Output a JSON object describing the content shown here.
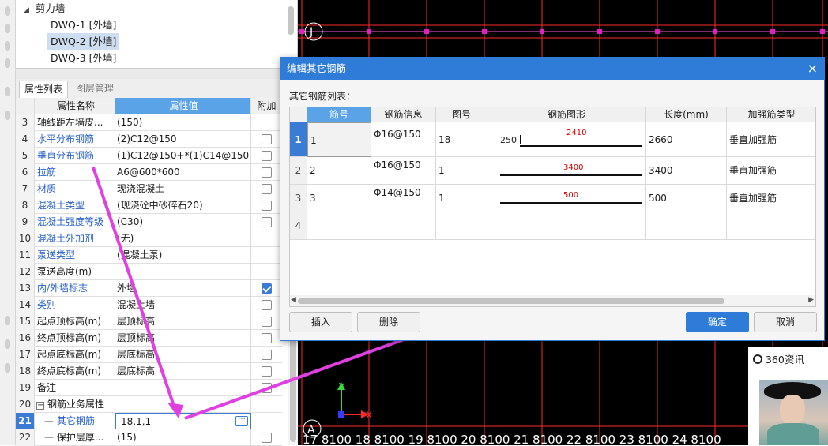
{
  "tree": {
    "root_label": "剪力墙",
    "items": [
      {
        "label": "DWQ-1 [外墙]"
      },
      {
        "label": "DWQ-2 [外墙]",
        "selected": true
      },
      {
        "label": "DWQ-3 [外墙]"
      }
    ]
  },
  "tabs": [
    {
      "label": "属性列表",
      "active": true
    },
    {
      "label": "图层管理",
      "active": false
    }
  ],
  "prop_grid": {
    "headers": {
      "name": "属性名称",
      "value": "属性值",
      "add": "附加"
    },
    "rows": [
      {
        "num": "3",
        "name": "轴线距左墙皮...",
        "value": "(150)",
        "check": false,
        "blue": false
      },
      {
        "num": "4",
        "name": "水平分布钢筋",
        "value": "(2)C12@150",
        "check": true,
        "blue": true
      },
      {
        "num": "5",
        "name": "垂直分布钢筋",
        "value": "(1)C12@150+*(1)C14@150",
        "check": true,
        "blue": true
      },
      {
        "num": "6",
        "name": "拉筋",
        "value": "A6@600*600",
        "check": true,
        "blue": true
      },
      {
        "num": "7",
        "name": "材质",
        "value": "现浇混凝土",
        "check": true,
        "blue": true
      },
      {
        "num": "8",
        "name": "混凝土类型",
        "value": "(现浇砼中砂碎石20)",
        "check": true,
        "blue": true
      },
      {
        "num": "9",
        "name": "混凝土强度等级",
        "value": "(C30)",
        "check": true,
        "blue": true
      },
      {
        "num": "10",
        "name": "混凝土外加剂",
        "value": "(无)",
        "check": null,
        "blue": true
      },
      {
        "num": "11",
        "name": "泵送类型",
        "value": "(混凝土泵)",
        "check": null,
        "blue": true
      },
      {
        "num": "12",
        "name": "泵送高度(m)",
        "value": "",
        "check": null,
        "blue": false
      },
      {
        "num": "13",
        "name": "内/外墙标志",
        "value": "外墙",
        "check": "on",
        "blue": true
      },
      {
        "num": "14",
        "name": "类别",
        "value": "混凝土墙",
        "check": true,
        "blue": true
      },
      {
        "num": "15",
        "name": "起点顶标高(m)",
        "value": "层顶标高",
        "check": true,
        "blue": false
      },
      {
        "num": "16",
        "name": "终点顶标高(m)",
        "value": "层顶标高",
        "check": true,
        "blue": false
      },
      {
        "num": "17",
        "name": "起点底标高(m)",
        "value": "层底标高",
        "check": true,
        "blue": false
      },
      {
        "num": "18",
        "name": "终点底标高(m)",
        "value": "层底标高",
        "check": true,
        "blue": false
      },
      {
        "num": "19",
        "name": "备注",
        "value": "",
        "check": true,
        "blue": false
      },
      {
        "num": "20",
        "name": "钢筋业务属性",
        "value": "",
        "check": null,
        "blue": false,
        "group": true
      },
      {
        "num": "21",
        "name": "其它钢筋",
        "value": "18,1,1",
        "check": null,
        "blue": true,
        "selected": true
      },
      {
        "num": "22",
        "name": "保护层厚...",
        "value": "(15)",
        "check": true,
        "blue": false
      }
    ]
  },
  "cad": {
    "axis_labels": {
      "top": "J",
      "bottom": "A",
      "x": "X",
      "y": "Y"
    },
    "dimension_text": "17 8100 18 8100 19 8100 20 8100 21 8100 22 8100 23 8100 24 8100"
  },
  "dialog": {
    "title": "编辑其它钢筋",
    "close_glyph": "×",
    "list_label": "其它钢筋列表：",
    "columns": [
      "筋号",
      "钢筋信息",
      "图号",
      "钢筋图形",
      "长度(mm)",
      "加强筋类型"
    ],
    "rows": [
      {
        "num": "1",
        "bar_no": "1",
        "info": "Φ16@150",
        "fig": "18",
        "shape_left": "250",
        "shape_main": "2410",
        "length": "2660",
        "type": "垂直加强筋"
      },
      {
        "num": "2",
        "bar_no": "2",
        "info": "Φ16@150",
        "fig": "1",
        "shape_left": "",
        "shape_main": "3400",
        "length": "3400",
        "type": "垂直加强筋"
      },
      {
        "num": "3",
        "bar_no": "3",
        "info": "Φ14@150",
        "fig": "1",
        "shape_left": "",
        "shape_main": "500",
        "length": "500",
        "type": "垂直加强筋"
      },
      {
        "num": "4",
        "bar_no": "",
        "info": "",
        "fig": "",
        "shape_left": "",
        "shape_main": "",
        "length": "",
        "type": ""
      }
    ],
    "buttons": {
      "insert": "插入",
      "delete": "删除",
      "ok": "确定",
      "cancel": "取消"
    }
  },
  "news": {
    "title": "360资讯"
  },
  "colors": {
    "accent": "#2f7bd8",
    "grid_red": "#ff2a2a",
    "cad_bg": "#000000",
    "arrow": "#e040e0"
  }
}
